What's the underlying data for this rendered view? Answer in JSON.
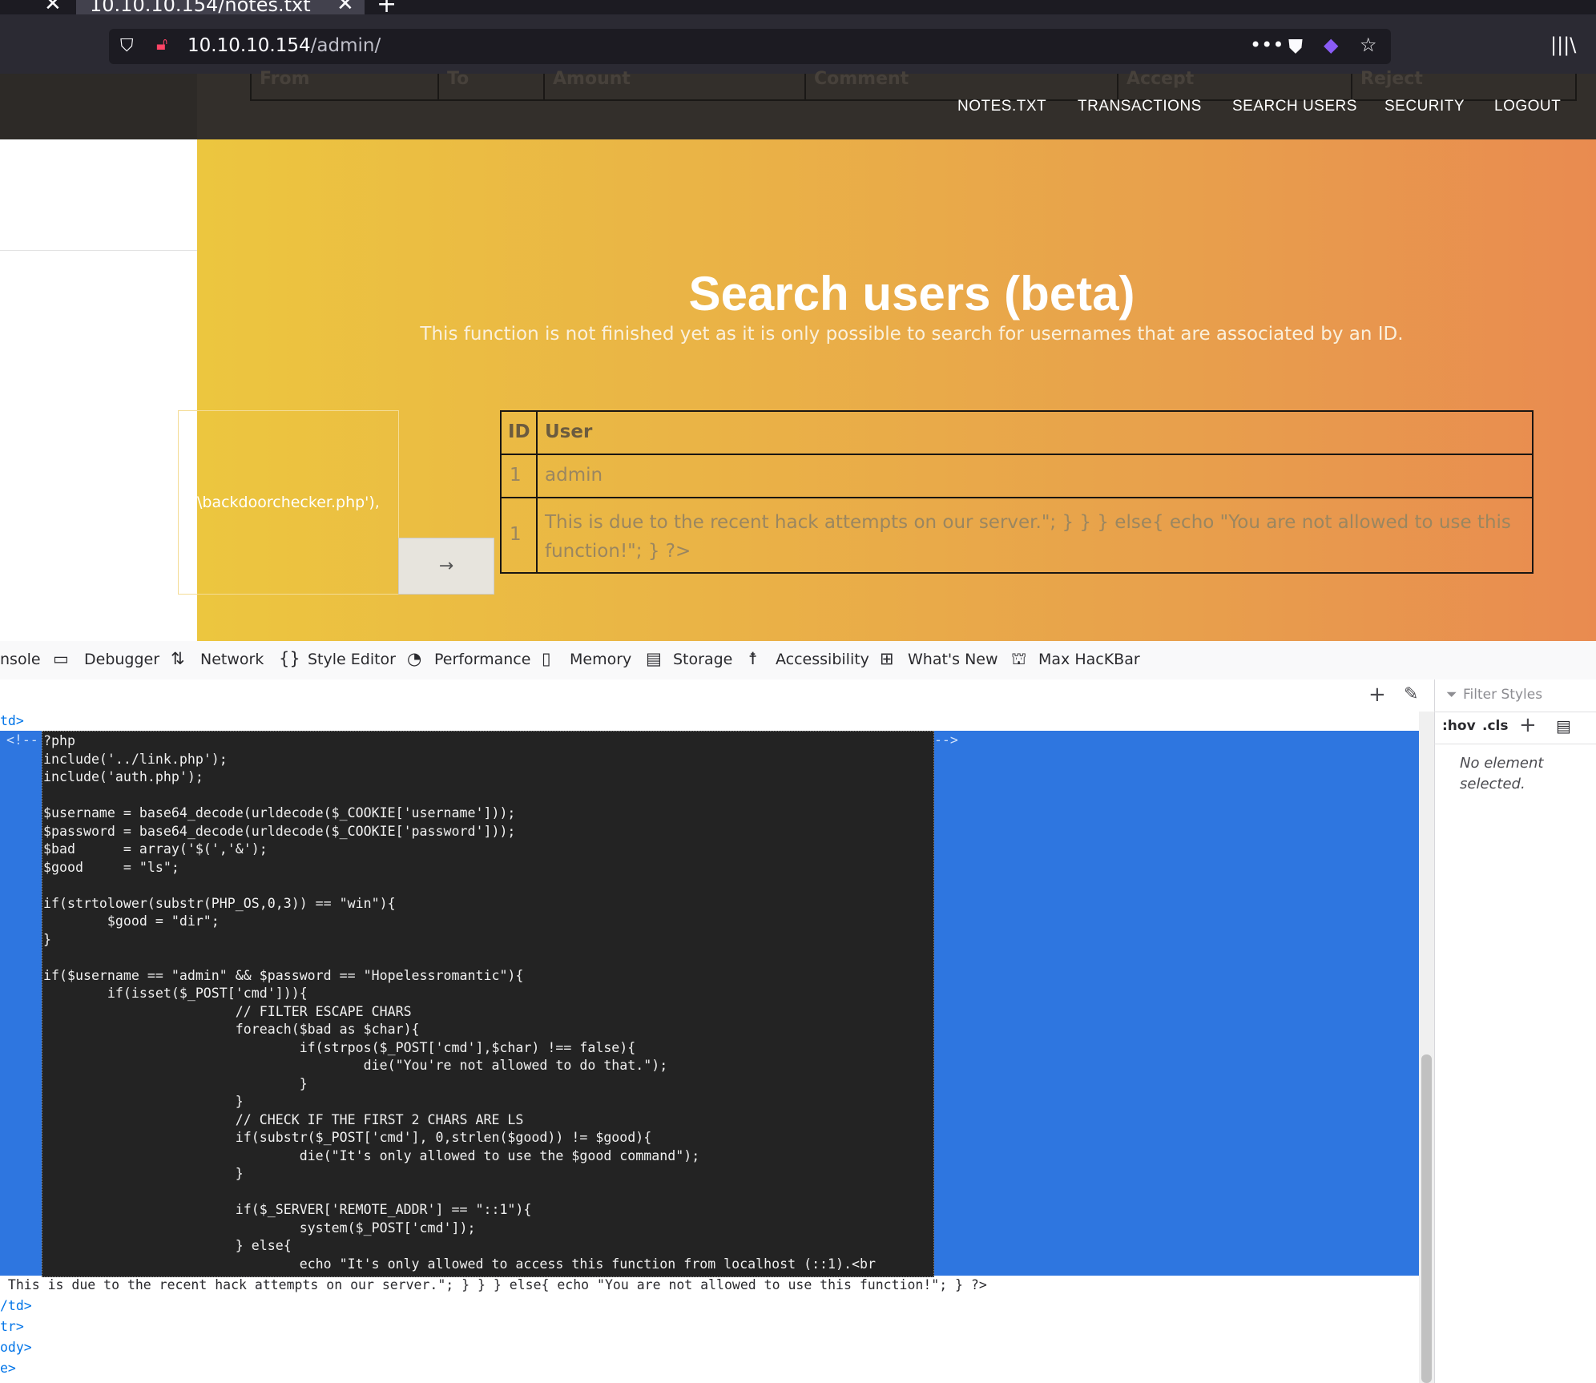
{
  "browser": {
    "tab_title": "10.10.10.154/notes.txt",
    "url_host": "10.10.10.154",
    "url_path": "/admin/"
  },
  "ghost_table_headers": [
    "From",
    "To",
    "Amount",
    "Comment",
    "Accept",
    "Reject"
  ],
  "nav": {
    "items": [
      "NOTES.TXT",
      "TRANSACTIONS",
      "SEARCH USERS",
      "SECURITY",
      "LOGOUT"
    ]
  },
  "hero": {
    "title": "Search users (beta)",
    "subtitle": "This function is not finished yet as it is only possible to search for usernames that are associated by an ID."
  },
  "search": {
    "input_value": "\\backdoorchecker.php'),",
    "button_arrow": "→"
  },
  "users_table": {
    "headers": [
      "ID",
      "User"
    ],
    "rows": [
      {
        "id": "1",
        "user": "admin"
      },
      {
        "id": "1",
        "user": "This is due to the recent hack attempts on our server.\"; } } } else{ echo \"You are not allowed to use this function!\"; } ?>"
      }
    ]
  },
  "devtools": {
    "tabs": [
      "nsole",
      "Debugger",
      "Network",
      "Style Editor",
      "Performance",
      "Memory",
      "Storage",
      "Accessibility",
      "What's New",
      "Max HacKBar"
    ],
    "filter_placeholder": "Filter Styles",
    "hov_label": ":hov",
    "cls_label": ".cls",
    "no_element": "No element selected.",
    "markup_top": "td>",
    "comment_open": "<!--",
    "comment_close": "-->",
    "code": "?php\ninclude('../link.php');\ninclude('auth.php');\n\n$username = base64_decode(urldecode($_COOKIE['username']));\n$password = base64_decode(urldecode($_COOKIE['password']));\n$bad      = array('$(','&');\n$good     = \"ls\";\n\nif(strtolower(substr(PHP_OS,0,3)) == \"win\"){\n        $good = \"dir\";\n}\n\nif($username == \"admin\" && $password == \"Hopelessromantic\"){\n        if(isset($_POST['cmd'])){\n                        // FILTER ESCAPE CHARS\n                        foreach($bad as $char){\n                                if(strpos($_POST['cmd'],$char) !== false){\n                                        die(\"You're not allowed to do that.\");\n                                }\n                        }\n                        // CHECK IF THE FIRST 2 CHARS ARE LS\n                        if(substr($_POST['cmd'], 0,strlen($good)) != $good){\n                                die(\"It's only allowed to use the $good command\");\n                        }\n\n                        if($_SERVER['REMOTE_ADDR'] == \"::1\"){\n                                system($_POST['cmd']);\n                        } else{\n                                echo \"It's only allowed to access this function from localhost (::1).<br",
    "after_code": " This is due to the recent hack attempts on our server.\"; } } } else{ echo \"You are not allowed to use this function!\"; } ?>",
    "closing_lines": [
      "/td>",
      "tr>",
      "ody>",
      "e>"
    ]
  }
}
